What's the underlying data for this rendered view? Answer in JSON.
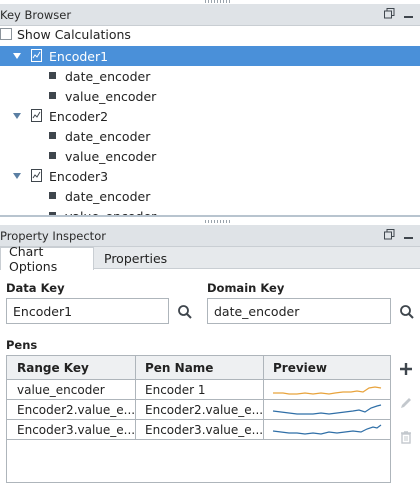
{
  "key_browser": {
    "title": "Key Browser",
    "show_calculations_label": "Show Calculations",
    "show_calculations_checked": false,
    "encoders": [
      {
        "label": "Encoder1",
        "selected": true,
        "expanded": true,
        "children": [
          "date_encoder",
          "value_encoder"
        ]
      },
      {
        "label": "Encoder2",
        "selected": false,
        "expanded": true,
        "children": [
          "date_encoder",
          "value_encoder"
        ]
      },
      {
        "label": "Encoder3",
        "selected": false,
        "expanded": true,
        "children": [
          "date_encoder",
          "value_encoder"
        ]
      }
    ]
  },
  "property_inspector": {
    "title": "Property Inspector",
    "tabs": [
      {
        "label": "Chart Options",
        "active": true
      },
      {
        "label": "Properties",
        "active": false
      }
    ],
    "data_key": {
      "label": "Data Key",
      "value": "Encoder1"
    },
    "domain_key": {
      "label": "Domain Key",
      "value": "date_encoder"
    },
    "pens": {
      "label": "Pens",
      "columns": [
        "Range Key",
        "Pen Name",
        "Preview"
      ],
      "rows": [
        {
          "range_key": "value_encoder",
          "pen_name": "Encoder 1",
          "preview_color": "#e8a33c"
        },
        {
          "range_key": "Encoder2.value_e...",
          "pen_name": "Encoder2.value_e...",
          "preview_color": "#2f6fa7"
        },
        {
          "range_key": "Encoder3.value_e...",
          "pen_name": "Encoder3.value_e...",
          "preview_color": "#2f6fa7"
        }
      ]
    }
  },
  "colors": {
    "selection": "#4a90d9",
    "header_bg": "#dfe3e7",
    "pen1": "#e8a33c",
    "pen2": "#2f6fa7"
  },
  "icons": {
    "restore": "restore-window-icon",
    "minimize": "minimize-icon",
    "search": "search-icon",
    "add": "plus-icon",
    "edit": "pencil-icon",
    "delete": "trash-icon",
    "encoder": "encoder-chart-icon"
  }
}
